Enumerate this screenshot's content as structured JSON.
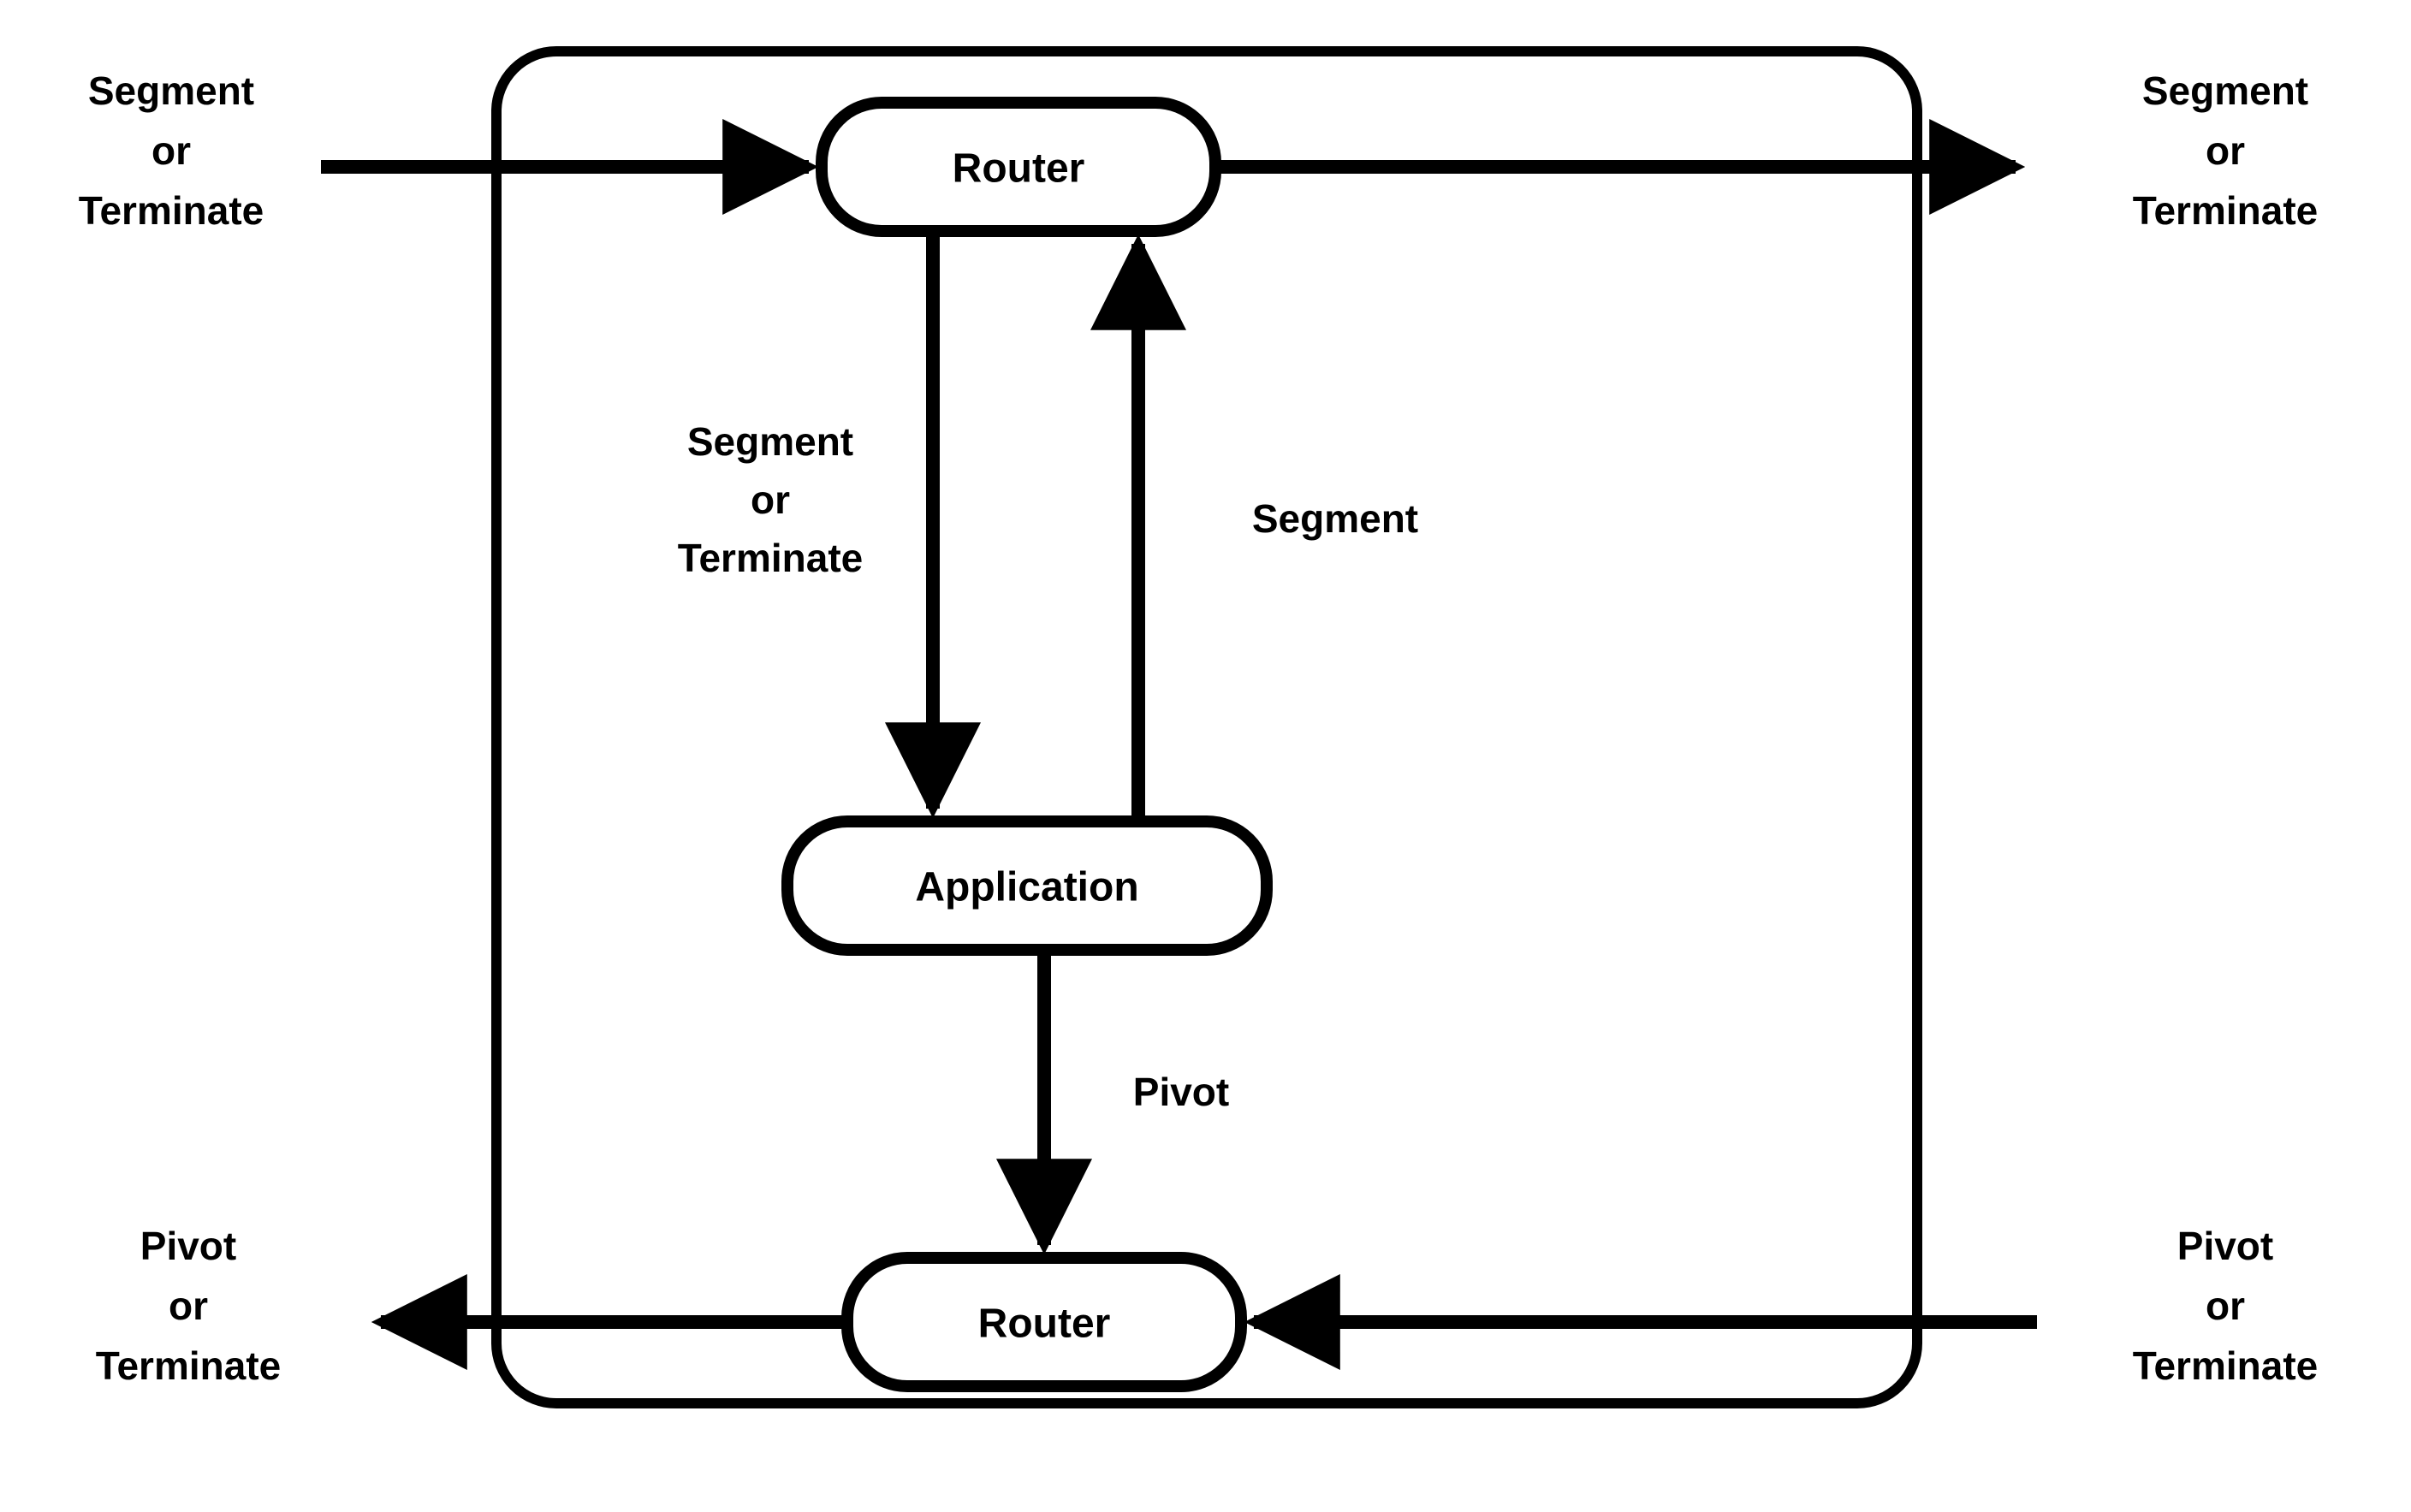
{
  "nodes": {
    "router_top": {
      "label": "Router"
    },
    "application": {
      "label": "Application"
    },
    "router_bottom": {
      "label": "Router"
    }
  },
  "edges": {
    "router_to_app": {
      "line1": "Segment",
      "line2": "or",
      "line3": "Terminate"
    },
    "app_to_router": {
      "line1": "Segment"
    },
    "app_to_router_b": {
      "line1": "Pivot"
    }
  },
  "external": {
    "top_left": {
      "line1": "Segment",
      "line2": "or",
      "line3": "Terminate"
    },
    "top_right": {
      "line1": "Segment",
      "line2": "or",
      "line3": "Terminate"
    },
    "bottom_left": {
      "line1": "Pivot",
      "line2": "or",
      "line3": "Terminate"
    },
    "bottom_right": {
      "line1": "Pivot",
      "line2": "or",
      "line3": "Terminate"
    }
  }
}
